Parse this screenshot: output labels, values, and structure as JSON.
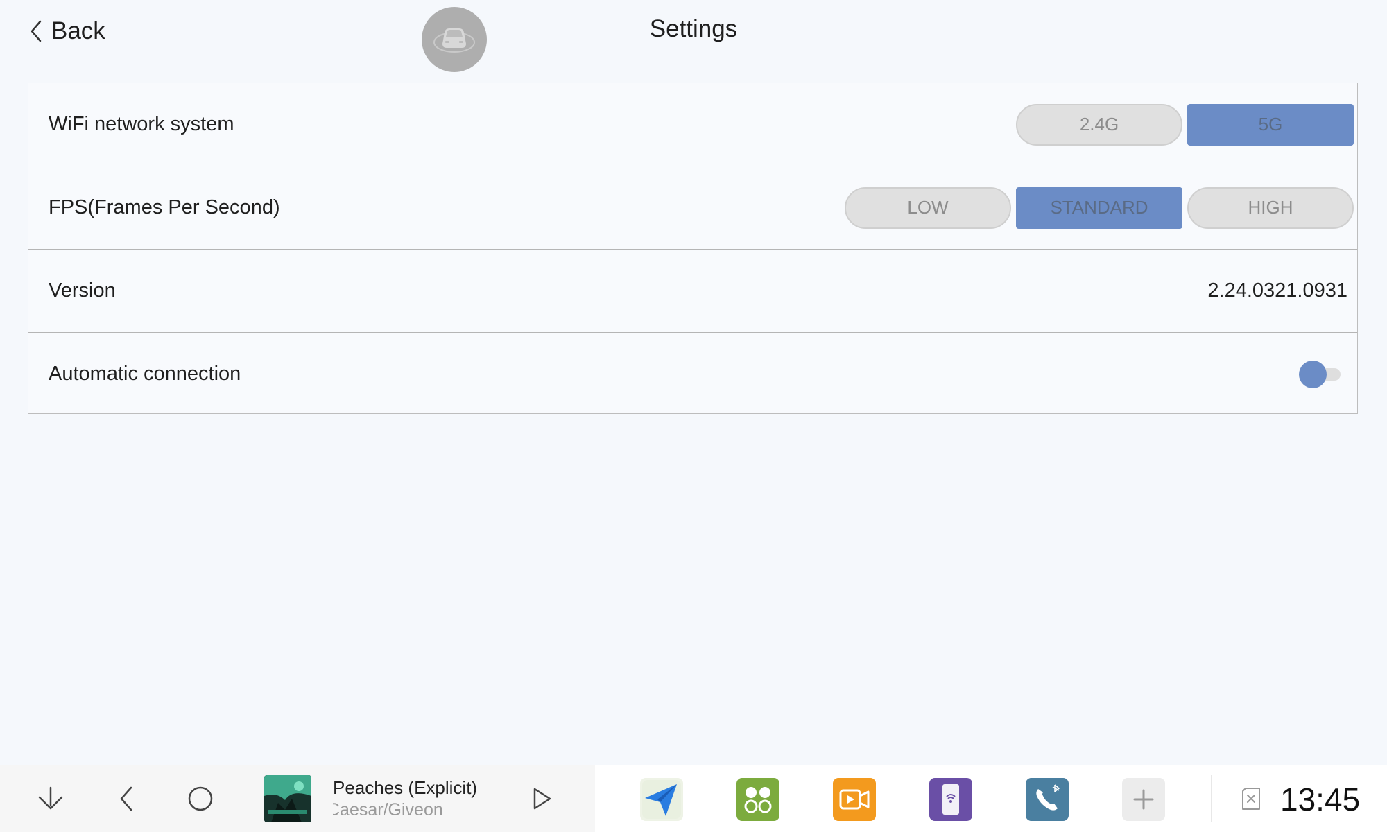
{
  "header": {
    "back_label": "Back",
    "title": "Settings"
  },
  "settings": {
    "wifi": {
      "label": "WiFi network system",
      "options": [
        "2.4G",
        "5G"
      ],
      "selected": "5G"
    },
    "fps": {
      "label": "FPS(Frames Per Second)",
      "options": [
        "LOW",
        "STANDARD",
        "HIGH"
      ],
      "selected": "STANDARD"
    },
    "version": {
      "label": "Version",
      "value": "2.24.0321.0931"
    },
    "auto_connect": {
      "label": "Automatic connection",
      "enabled": false
    }
  },
  "dock": {
    "now_playing": {
      "title": "Peaches (Explicit)",
      "artist": "Caesar/Giveon"
    },
    "apps": [
      "navigation-app",
      "apps-grid-app",
      "video-app",
      "phone-wifi-app",
      "bluetooth-phone-app",
      "add-app"
    ],
    "clock": "13:45"
  },
  "colors": {
    "accent": "#6b8cc6",
    "background": "#f5f8fc",
    "segment_inactive": "#e0e0e0"
  }
}
